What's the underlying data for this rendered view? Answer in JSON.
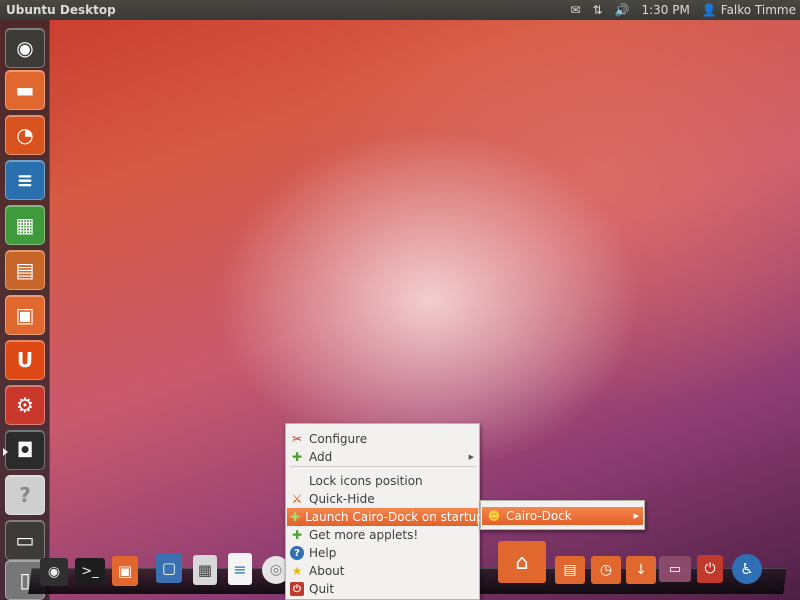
{
  "top_panel": {
    "title": "Ubuntu Desktop",
    "indicators": [
      {
        "name": "mail-icon",
        "glyph": "✉"
      },
      {
        "name": "network-icon",
        "glyph": "⇅"
      },
      {
        "name": "volume-icon",
        "glyph": "🔊"
      }
    ],
    "clock": "1:30 PM",
    "user_glyph": "👤",
    "user": "Falko Timme"
  },
  "launcher": {
    "items": [
      {
        "name": "dash-home-button",
        "icon": "ubuntu-logo-icon",
        "glyph": "◉",
        "color": "#3c3b37"
      },
      {
        "name": "home-folder-launcher",
        "icon": "folder-icon",
        "glyph": "▬",
        "color": "#e0672e"
      },
      {
        "name": "firefox-launcher",
        "icon": "firefox-icon",
        "glyph": "◔",
        "color": "#d9531e"
      },
      {
        "name": "libreoffice-writer-launcher",
        "icon": "writer-icon",
        "glyph": "≡",
        "color": "#2a6fae"
      },
      {
        "name": "libreoffice-calc-launcher",
        "icon": "calc-icon",
        "glyph": "▦",
        "color": "#3f9a3b"
      },
      {
        "name": "libreoffice-impress-launcher",
        "icon": "impress-icon",
        "glyph": "▤",
        "color": "#c9662a"
      },
      {
        "name": "software-center-launcher",
        "icon": "shopping-bag-icon",
        "glyph": "▣",
        "color": "#e0672e"
      },
      {
        "name": "ubuntu-one-launcher",
        "icon": "ubuntu-one-icon",
        "glyph": "U",
        "color": "#dd4814"
      },
      {
        "name": "system-settings-launcher",
        "icon": "gear-wrench-icon",
        "glyph": "⚙",
        "color": "#c9382a"
      },
      {
        "name": "cairo-dock-launcher",
        "icon": "cairo-dock-icon",
        "glyph": "◘",
        "color": "#2b2b2b"
      },
      {
        "name": "help-launcher",
        "icon": "question-icon",
        "glyph": "?",
        "color": "#cfcfcf"
      },
      {
        "name": "workspace-switcher-launcher",
        "icon": "workspace-icon",
        "glyph": "▭",
        "color": "#3c3b37"
      },
      {
        "name": "trash-launcher",
        "icon": "trash-icon",
        "glyph": "▯",
        "color": "#777777"
      }
    ]
  },
  "dock": {
    "items": [
      {
        "name": "dock-ubuntu-icon",
        "glyph": "◉"
      },
      {
        "name": "dock-terminal-icon",
        "glyph": ">_"
      },
      {
        "name": "dock-software-center-icon",
        "glyph": "▣"
      },
      {
        "name": "dock-display-icon",
        "glyph": "▢"
      },
      {
        "name": "dock-calculator-icon",
        "glyph": "▦"
      },
      {
        "name": "dock-document-icon",
        "glyph": "≡"
      },
      {
        "name": "dock-disc-icon",
        "glyph": "◎"
      },
      {
        "name": "dock-home-folder-icon",
        "glyph": "⌂"
      },
      {
        "name": "dock-documents-folder-icon",
        "glyph": "▤"
      },
      {
        "name": "dock-recent-folder-icon",
        "glyph": "◷"
      },
      {
        "name": "dock-downloads-folder-icon",
        "glyph": "↓"
      },
      {
        "name": "dock-window-icon",
        "glyph": "▭"
      },
      {
        "name": "dock-power-icon",
        "glyph": "⏻"
      },
      {
        "name": "dock-accessibility-icon",
        "glyph": "♿"
      }
    ]
  },
  "context_menu": {
    "items": [
      {
        "name": "configure",
        "label": "Configure",
        "icon": "wrench-icon",
        "glyph": "✂",
        "icon_color": "#c0392b"
      },
      {
        "name": "add",
        "label": "Add",
        "icon": "plus-icon",
        "glyph": "✚",
        "icon_color": "#4aa32b",
        "submenu": true,
        "arrow": "▶"
      },
      {
        "name": "lock-icons-position",
        "label": "Lock icons position"
      },
      {
        "name": "quick-hide",
        "label": "Quick-Hide",
        "icon": "hide-icon",
        "glyph": "⚔",
        "icon_color": "#d35400"
      },
      {
        "name": "launch-cairo-dock-on-startup",
        "label": "Launch Cairo-Dock on startup",
        "icon": "plus-icon",
        "glyph": "✚",
        "icon_color": "#9be36c",
        "highlighted": true
      },
      {
        "name": "get-more-applets",
        "label": "Get more applets!",
        "icon": "plus-icon",
        "glyph": "✚",
        "icon_color": "#4aa32b"
      },
      {
        "name": "help",
        "label": "Help",
        "icon": "help-icon",
        "glyph": "?",
        "icon_color": "#2f6fb5"
      },
      {
        "name": "about",
        "label": "About",
        "icon": "star-icon",
        "glyph": "★",
        "icon_color": "#e8b90c"
      },
      {
        "name": "quit",
        "label": "Quit",
        "icon": "power-icon",
        "glyph": "⏻",
        "icon_color": "#c0392b"
      }
    ]
  },
  "submenu": {
    "label": "Cairo-Dock",
    "icon": "cairo-dock-icon",
    "glyph": "☻",
    "arrow": "▶"
  }
}
